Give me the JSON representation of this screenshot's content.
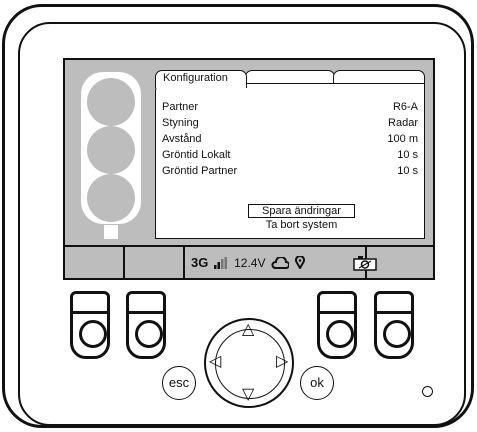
{
  "tabs": [
    {
      "label": "Konfiguration"
    },
    {
      "label": ""
    },
    {
      "label": ""
    }
  ],
  "settings": [
    {
      "label": "Partner",
      "value": "R6-A"
    },
    {
      "label": "Styning",
      "value": "Radar"
    },
    {
      "label": "Avstånd",
      "value": "100 m"
    },
    {
      "label": "Gröntid Lokalt",
      "value": "10 s"
    },
    {
      "label": "Gröntid Partner",
      "value": "10 s"
    }
  ],
  "actions": {
    "save_label": "Spara ändringar",
    "remove_label": "Ta bort system"
  },
  "status": {
    "network": "3G",
    "voltage": "12.4V",
    "icons": [
      "signal-icon",
      "cloud-icon",
      "location-pin-icon",
      "camera-icon"
    ]
  },
  "hardware": {
    "esc_label": "esc",
    "ok_label": "ok"
  }
}
